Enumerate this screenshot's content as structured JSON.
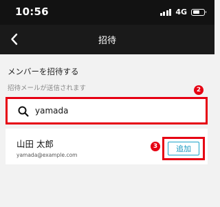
{
  "status_bar": {
    "time": "10:56",
    "network": "4G",
    "signal_icon": "signal-bars-icon",
    "battery_icon": "battery-icon",
    "battery_level": 0.6
  },
  "nav": {
    "back_icon": "chevron-left-icon",
    "title": "招待"
  },
  "invite": {
    "heading": "メンバーを招待する",
    "description": "招待メールが送信されます"
  },
  "search": {
    "icon": "search-icon",
    "value": "yamada",
    "placeholder": ""
  },
  "result": {
    "name": "山田 太郎",
    "email": "yamada@example.com",
    "add_label": "追加"
  },
  "annotations": {
    "step2": "2",
    "step3": "3"
  },
  "colors": {
    "highlight": "#e60012",
    "accent": "#1a9ac0",
    "header_bg": "#1a1a1a",
    "page_bg": "#f2f2f2"
  }
}
